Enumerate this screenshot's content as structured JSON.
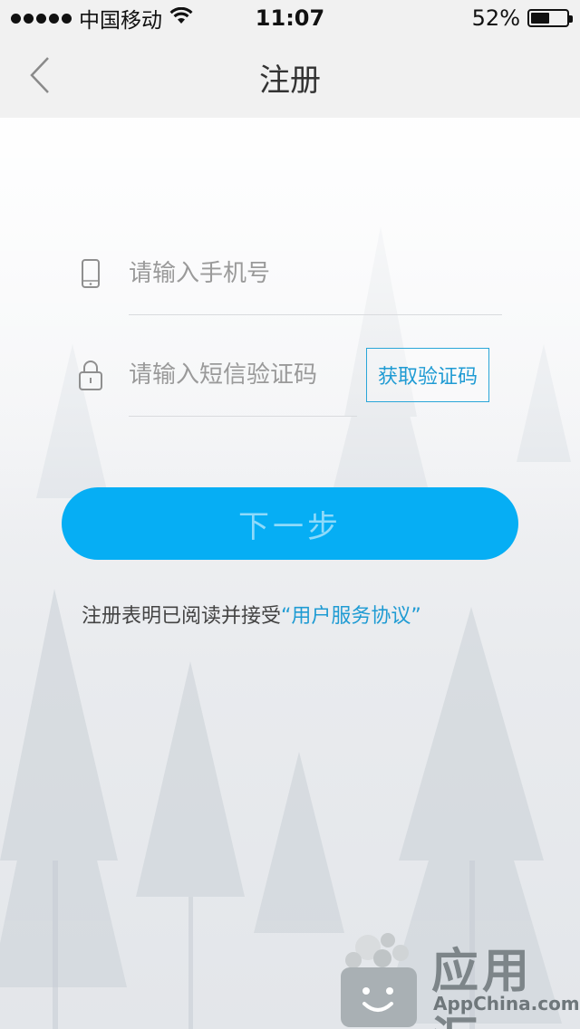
{
  "status_bar": {
    "carrier": "中国移动",
    "time": "11:07",
    "battery_percent": "52%",
    "battery_level": 0.52
  },
  "nav": {
    "title": "注册",
    "back_icon": "chevron-left-icon"
  },
  "form": {
    "phone_placeholder": "请输入手机号",
    "code_placeholder": "请输入短信验证码",
    "get_code_label": "获取验证码",
    "next_label": "下一步"
  },
  "agreement": {
    "prefix": "注册表明已阅读并接受",
    "link": "“用户服务协议”"
  },
  "watermark": {
    "brand": "应用汇",
    "domain": "AppChina.com"
  },
  "colors": {
    "accent": "#06aef4",
    "link": "#1f9bd3"
  }
}
